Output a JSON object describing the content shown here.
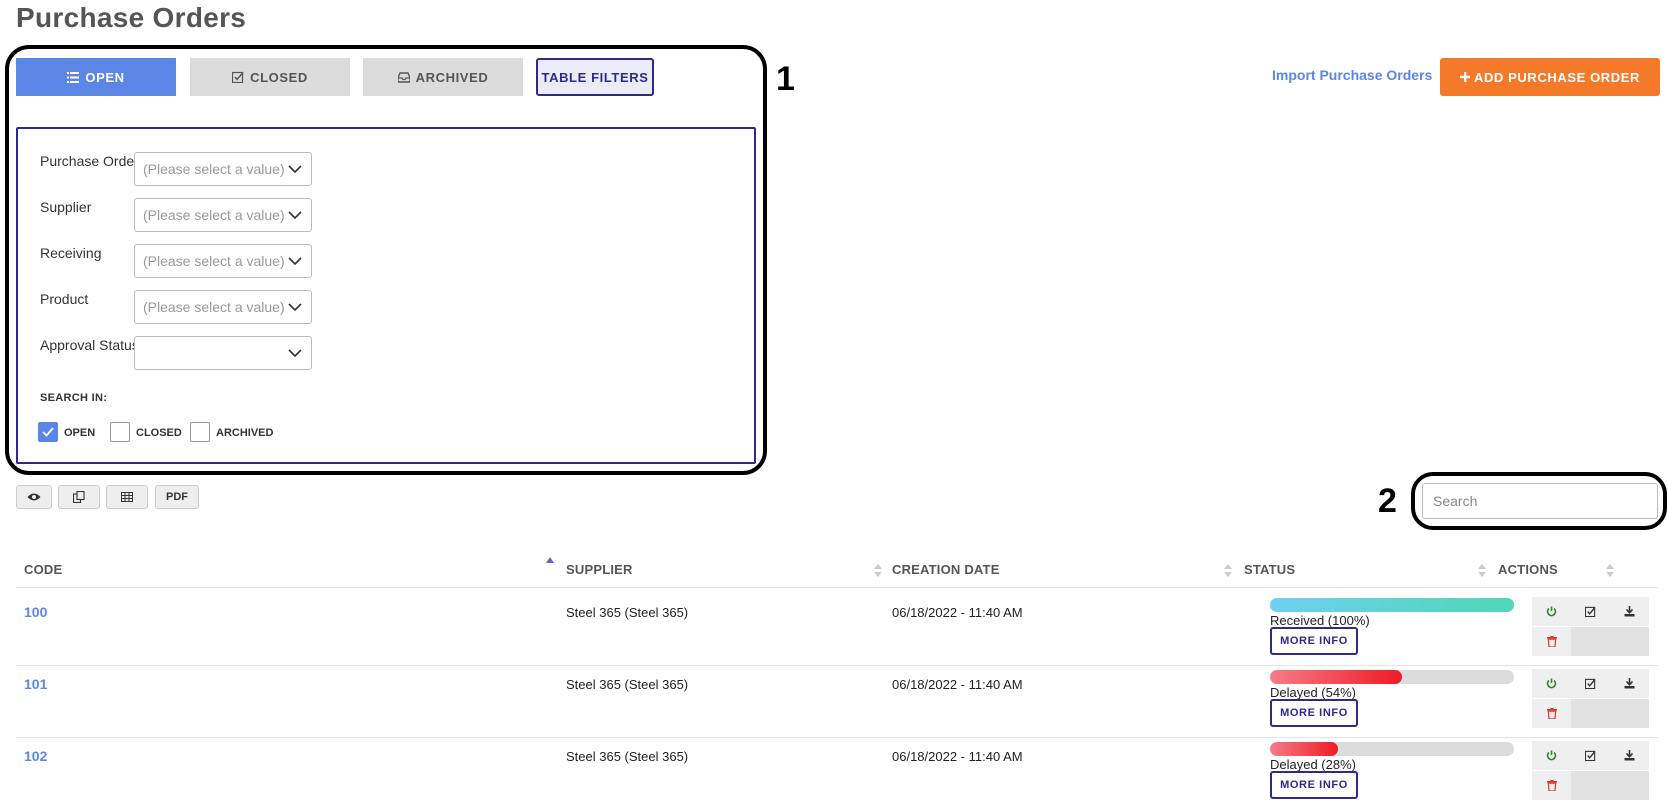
{
  "page": {
    "title": "Purchase Orders"
  },
  "tabs": [
    {
      "label": "OPEN",
      "icon": "list-icon",
      "active": true
    },
    {
      "label": "CLOSED",
      "icon": "check-square-icon",
      "active": false
    },
    {
      "label": "ARCHIVED",
      "icon": "inbox-icon",
      "active": false
    },
    {
      "label": "TABLE FILTERS",
      "active": true
    }
  ],
  "header": {
    "import_label": "Import Purchase Orders",
    "add_label": "ADD PURCHASE ORDER",
    "add_color": "#f47a2a",
    "accent_color": "#5b86e5",
    "filter_color": "#2e2a8a"
  },
  "annotations": {
    "box1": "1",
    "box2": "2"
  },
  "filters": {
    "fields": [
      {
        "label": "Purchase Order",
        "placeholder": "(Please select a value)"
      },
      {
        "label": "Supplier",
        "placeholder": "(Please select a value)"
      },
      {
        "label": "Receiving",
        "placeholder": "(Please select a value)"
      },
      {
        "label": "Product",
        "placeholder": "(Please select a value)"
      },
      {
        "label": "Approval Status",
        "placeholder": ""
      }
    ],
    "search_in_label": "SEARCH IN:",
    "checkboxes": [
      {
        "label": "OPEN",
        "checked": true
      },
      {
        "label": "CLOSED",
        "checked": false
      },
      {
        "label": "ARCHIVED",
        "checked": false
      }
    ]
  },
  "toolbar": {
    "buttons": [
      "eye-icon",
      "copy-icon",
      "table-icon",
      "PDF"
    ],
    "pdf_label": "PDF",
    "search_placeholder": "Search"
  },
  "table": {
    "columns": [
      "CODE",
      "SUPPLIER",
      "CREATION DATE",
      "STATUS",
      "ACTIONS"
    ],
    "rows": [
      {
        "code": "100",
        "supplier": "Steel 365 (Steel 365)",
        "date": "06/18/2022 - 11:40 AM",
        "status": "Received (100%)",
        "progress": 1.0,
        "kind": "received",
        "more": "MORE INFO"
      },
      {
        "code": "101",
        "supplier": "Steel 365 (Steel 365)",
        "date": "06/18/2022 - 11:40 AM",
        "status": "Delayed (54%)",
        "progress": 0.54,
        "kind": "delayed",
        "more": "MORE INFO"
      },
      {
        "code": "102",
        "supplier": "Steel 365 (Steel 365)",
        "date": "06/18/2022 - 11:40 AM",
        "status": "Delayed (28%)",
        "progress": 0.28,
        "kind": "delayed",
        "more": "MORE INFO"
      }
    ],
    "action_icons": [
      "power-icon",
      "check-square-icon",
      "download-icon",
      "trash-icon"
    ]
  }
}
